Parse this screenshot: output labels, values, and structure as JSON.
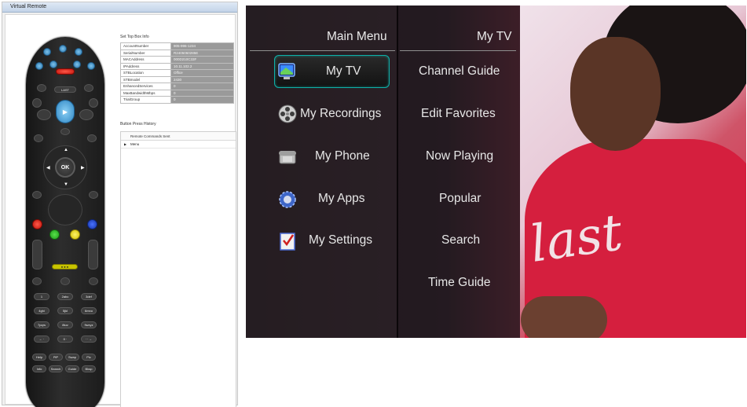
{
  "virtual_remote": {
    "window_title": "Virtual Remote",
    "info_title": "Set Top Box Info",
    "info_rows": [
      {
        "key": "AccountNumber",
        "value": "905-996-1234"
      },
      {
        "key": "SerialNumber",
        "value": "R2405060285E"
      },
      {
        "key": "MACAddress",
        "value": "000D210C33F"
      },
      {
        "key": "IPAddress",
        "value": "10.11.102.2"
      },
      {
        "key": "STBLocation",
        "value": "Office"
      },
      {
        "key": "STBmodel",
        "value": "2430"
      },
      {
        "key": "EnhancedServices",
        "value": "0"
      },
      {
        "key": "MaxBandwidthMbps",
        "value": "0"
      },
      {
        "key": "TrialGroup",
        "value": "0"
      }
    ],
    "history_title": "Button Press History",
    "history_header": "Remote Commands Sent",
    "history_rows": [
      {
        "marker": "▶",
        "label": "Menu"
      }
    ],
    "remote_labels": {
      "ok": "OK",
      "last": "LAST",
      "yellow_bar": "● ● ●",
      "numbers": [
        "1",
        "2abc",
        "3def",
        "4ghi",
        "5jkl",
        "6mno",
        "7pqrs",
        "8tuv",
        "9wxyz",
        "← ·",
        "0 ·",
        "·· →"
      ],
      "bottom_keys": [
        "Help",
        "PiP",
        "Swap",
        "Pic",
        "Info",
        "Search",
        "Guide",
        "Bksp"
      ]
    }
  },
  "tv_menu": {
    "main_header": "Main Menu",
    "sub_header": "My TV",
    "main_items": [
      {
        "label": "My TV",
        "icon": "tv-icon"
      },
      {
        "label": "My Recordings",
        "icon": "film-reel-icon"
      },
      {
        "label": "My Phone",
        "icon": "phone-icon"
      },
      {
        "label": "My Apps",
        "icon": "gear-icon"
      },
      {
        "label": "My Settings",
        "icon": "checklist-icon"
      }
    ],
    "sub_items": [
      "Channel Guide",
      "Edit Favorites",
      "Now Playing",
      "Popular",
      "Search",
      "Time Guide"
    ],
    "selected_main_index": 0,
    "highlight_color": "#0fb0a8",
    "shirt_text": "last"
  }
}
